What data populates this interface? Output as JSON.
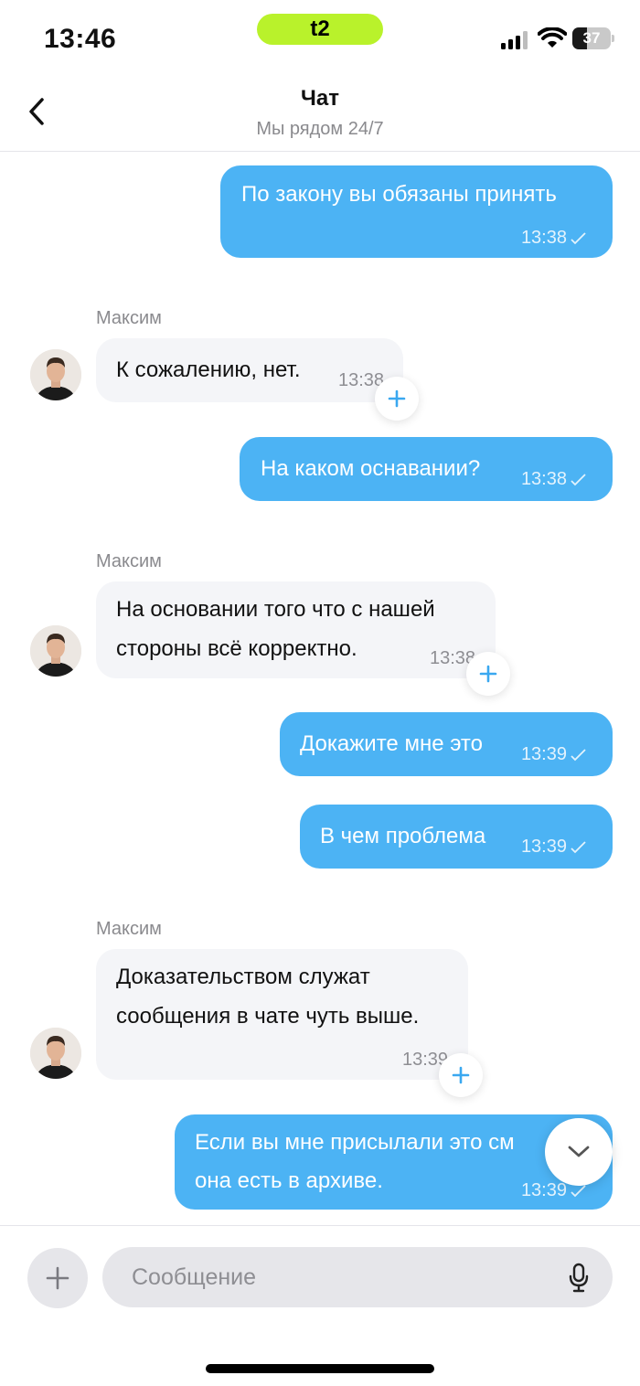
{
  "status_bar": {
    "time": "13:46",
    "carrier_logo": "t2",
    "battery_level": "37",
    "battery_fraction": 0.37,
    "icons": [
      "signal-icon",
      "wifi-icon",
      "battery-icon"
    ]
  },
  "header": {
    "title": "Чат",
    "subtitle": "Мы рядом 24/7",
    "back_icon": "chevron-left-icon"
  },
  "messages": [
    {
      "direction": "out",
      "text": "По закону вы обязаны принять",
      "time": "13:38",
      "status": "sent"
    },
    {
      "direction": "in",
      "sender": "Максим",
      "text": "К сожалению, нет.",
      "time": "13:38"
    },
    {
      "direction": "out",
      "text": "На каком оснавании?",
      "time": "13:38",
      "status": "sent"
    },
    {
      "direction": "in",
      "sender": "Максим",
      "text_lines": [
        "На основании того что с нашей",
        "стороны всё корректно."
      ],
      "time": "13:38"
    },
    {
      "direction": "out",
      "text": "Докажите мне это",
      "time": "13:39",
      "status": "sent"
    },
    {
      "direction": "out",
      "text": "В чем проблема",
      "time": "13:39",
      "status": "sent"
    },
    {
      "direction": "in",
      "sender": "Максим",
      "text_lines": [
        "Доказательством служат",
        "сообщения в чате чуть выше."
      ],
      "time": "13:39"
    },
    {
      "direction": "out",
      "text_lines": [
        "Если вы мне присылали это см",
        "она есть в архиве."
      ],
      "time": "13:39",
      "status": "sent"
    }
  ],
  "composer": {
    "placeholder": "Сообщение",
    "attach_icon": "plus-icon",
    "mic_icon": "microphone-icon"
  },
  "colors": {
    "outgoing_bubble": "#4cb3f4",
    "incoming_bubble": "#f4f5f8",
    "carrier_accent": "#b9f22b",
    "react_plus": "#3aa8f0"
  }
}
